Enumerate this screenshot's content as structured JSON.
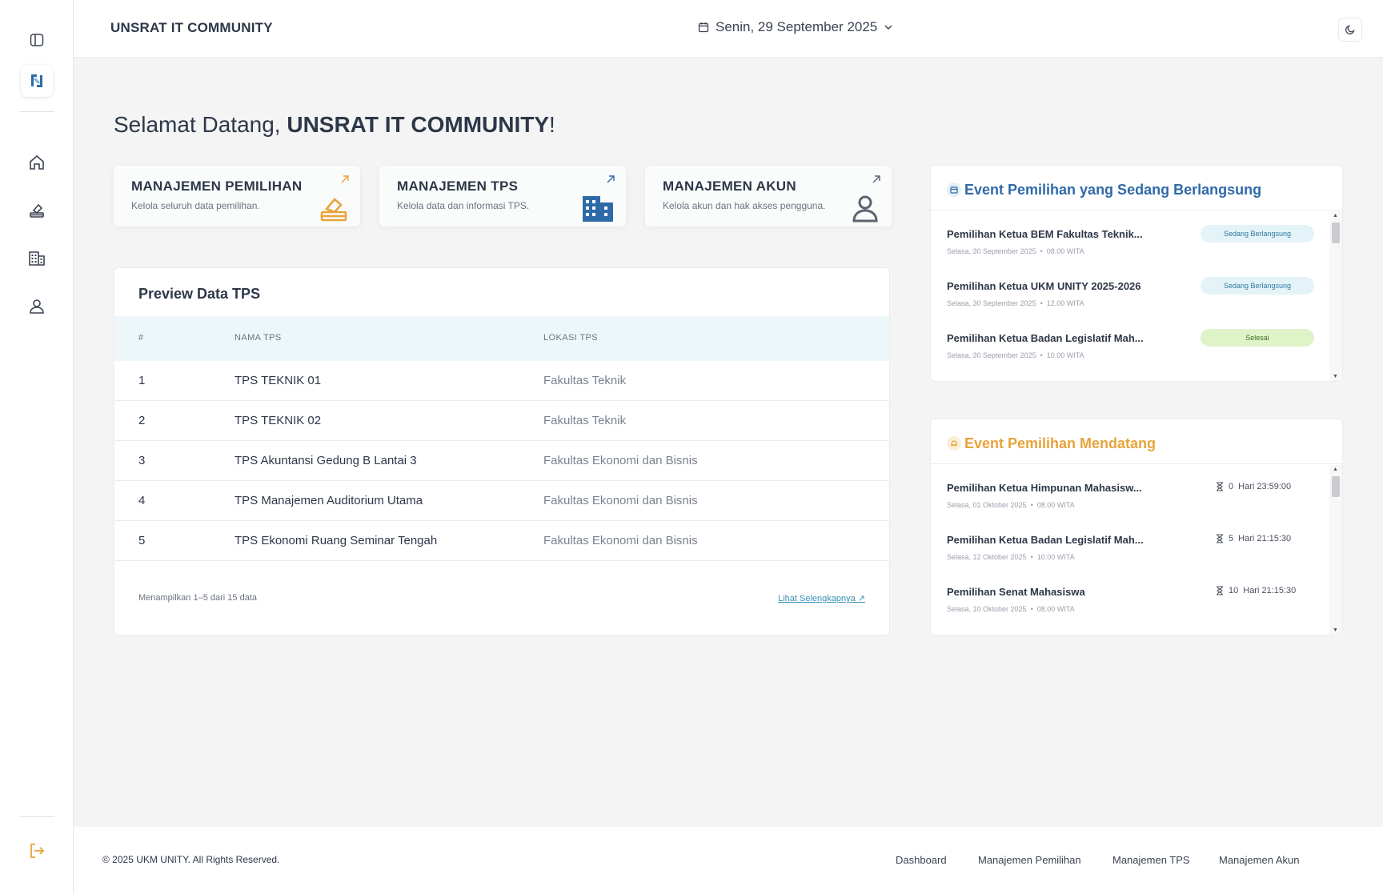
{
  "header": {
    "brand": "UNSRAT IT COMMUNITY",
    "date": "Senin, 29 September 2025"
  },
  "welcome": {
    "prefix": "Selamat Datang, ",
    "name": "UNSRAT IT COMMUNITY",
    "suffix": "!"
  },
  "cards": [
    {
      "title": "MANAJEMEN PEMILIHAN",
      "desc": "Kelola seluruh data pemilihan.",
      "icon": "ballot-box-icon",
      "color": "#e8a33a"
    },
    {
      "title": "MANAJEMEN TPS",
      "desc": "Kelola data dan informasi TPS.",
      "icon": "building-icon",
      "color": "#2f6aa8"
    },
    {
      "title": "MANAJEMEN AKUN",
      "desc": "Kelola akun dan hak akses pengguna.",
      "icon": "user-icon",
      "color": "#5a6470"
    }
  ],
  "tps": {
    "title": "Preview Data TPS",
    "columns": [
      "#",
      "NAMA TPS",
      "LOKASI TPS"
    ],
    "rows": [
      {
        "no": "1",
        "name": "TPS TEKNIK 01",
        "location": "Fakultas Teknik"
      },
      {
        "no": "2",
        "name": "TPS TEKNIK 02",
        "location": "Fakultas Teknik"
      },
      {
        "no": "3",
        "name": "TPS Akuntansi Gedung B Lantai 3",
        "location": "Fakultas Ekonomi dan Bisnis"
      },
      {
        "no": "4",
        "name": "TPS Manajemen Auditorium Utama",
        "location": "Fakultas Ekonomi dan Bisnis"
      },
      {
        "no": "5",
        "name": "TPS Ekonomi Ruang Seminar Tengah",
        "location": "Fakultas Ekonomi dan Bisnis"
      }
    ],
    "footer": "Menampilkan 1–5 dari 15 data",
    "more": "Lihat Selengkapnya ↗"
  },
  "ongoing": {
    "title": "Event Pemilihan yang Sedang Berlangsung",
    "color": "#2f6aa8",
    "items": [
      {
        "name": "Pemilihan Ketua BEM Fakultas Teknik...",
        "date": "Selasa, 30 September 2025",
        "time": "08.00 WITA",
        "status": "Sedang Berlangsung"
      },
      {
        "name": "Pemilihan Ketua UKM UNITY 2025-2026",
        "date": "Selasa, 30 September 2025",
        "time": "12.00 WITA",
        "status": "Sedang Berlangsung"
      },
      {
        "name": "Pemilihan Ketua Badan Legislatif Mah...",
        "date": "Selasa, 30 September 2025",
        "time": "10.00 WITA",
        "status": "Selesai"
      }
    ]
  },
  "upcoming": {
    "title": "Event Pemilihan Mendatang",
    "color": "#e8a33a",
    "items": [
      {
        "name": "Pemilihan Ketua Himpunan Mahasisw...",
        "date": "Selasa, 01 Oktober 2025",
        "time": "08.00 WITA",
        "days": "0",
        "countdown": "Hari 23:59:00"
      },
      {
        "name": "Pemilihan Ketua Badan Legislatif Mah...",
        "date": "Selasa, 12 Oktober 2025",
        "time": "10.00 WITA",
        "days": "5",
        "countdown": "Hari 21:15:30"
      },
      {
        "name": "Pemilihan Senat Mahasiswa",
        "date": "Selasa, 10 Oktober 2025",
        "time": "08.00 WITA",
        "days": "10",
        "countdown": "Hari 21:15:30"
      }
    ]
  },
  "footer": {
    "copyright": "© 2025 UKM UNITY. All Rights Reserved.",
    "nav": [
      "Dashboard",
      "Manajemen Pemilihan",
      "Manajemen TPS",
      "Manajemen Akun"
    ]
  },
  "separator": "•",
  "colors": {
    "accent_orange": "#e8a33a",
    "accent_blue": "#2f6aa8",
    "logout": "#e8a33a"
  }
}
